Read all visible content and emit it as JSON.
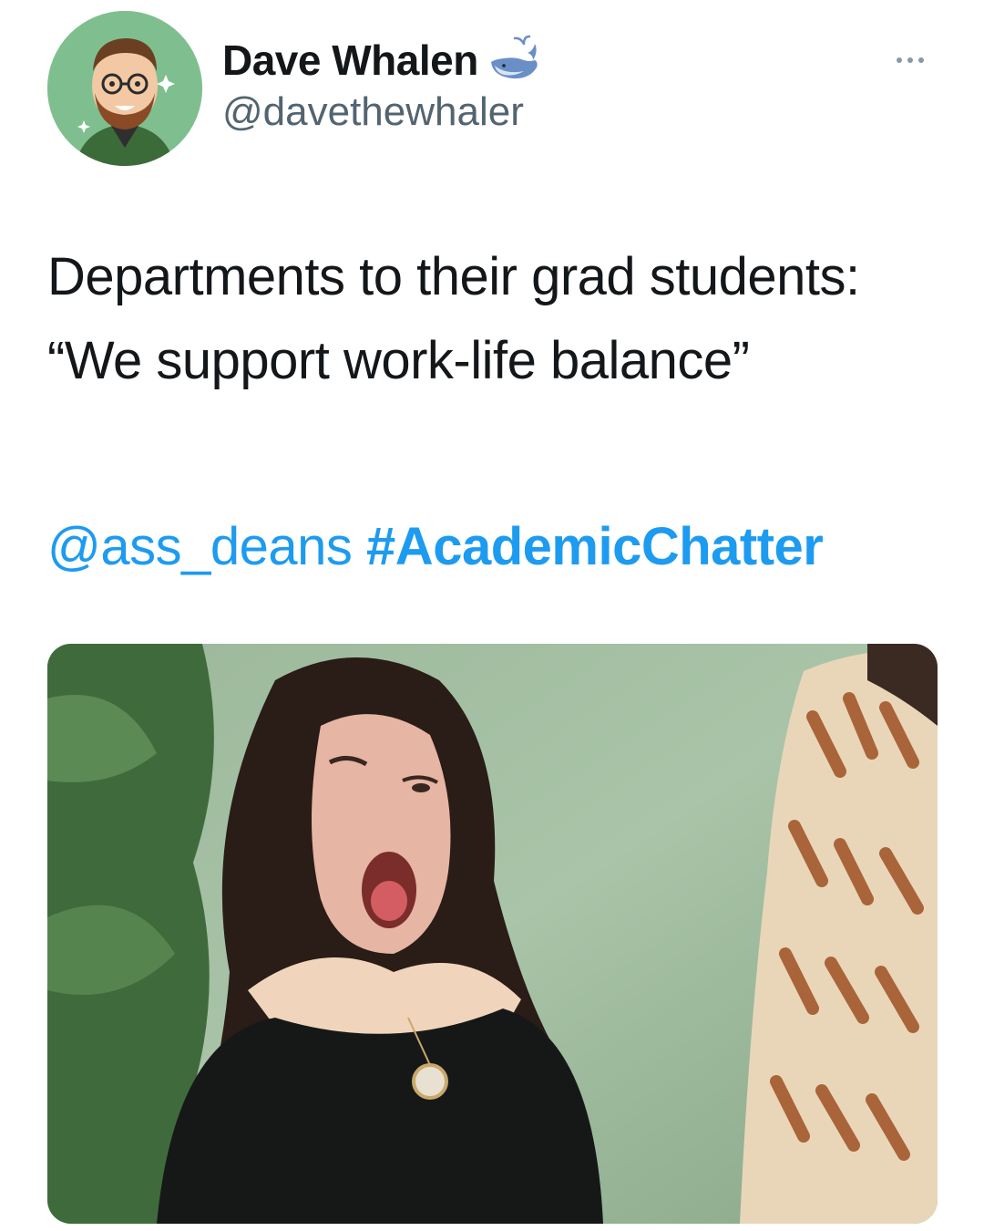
{
  "tweet": {
    "author": {
      "display_name": "Dave Whalen",
      "handle": "@davethewhaler",
      "verified_icon": "whale-icon",
      "avatar_icon": "cartoon-avatar"
    },
    "menu_icon": "more-options-icon",
    "text": "Departments to their grad students: “We support work-life balance”",
    "mention": "@ass_deans",
    "hashtag": "#AcademicChatter",
    "media": {
      "type": "photo",
      "subject": "reaction-photo"
    }
  },
  "colors": {
    "link": "#1d9bf0",
    "text": "#14171a",
    "secondary": "#536471",
    "avatar_bg": "#7fbf8f"
  }
}
